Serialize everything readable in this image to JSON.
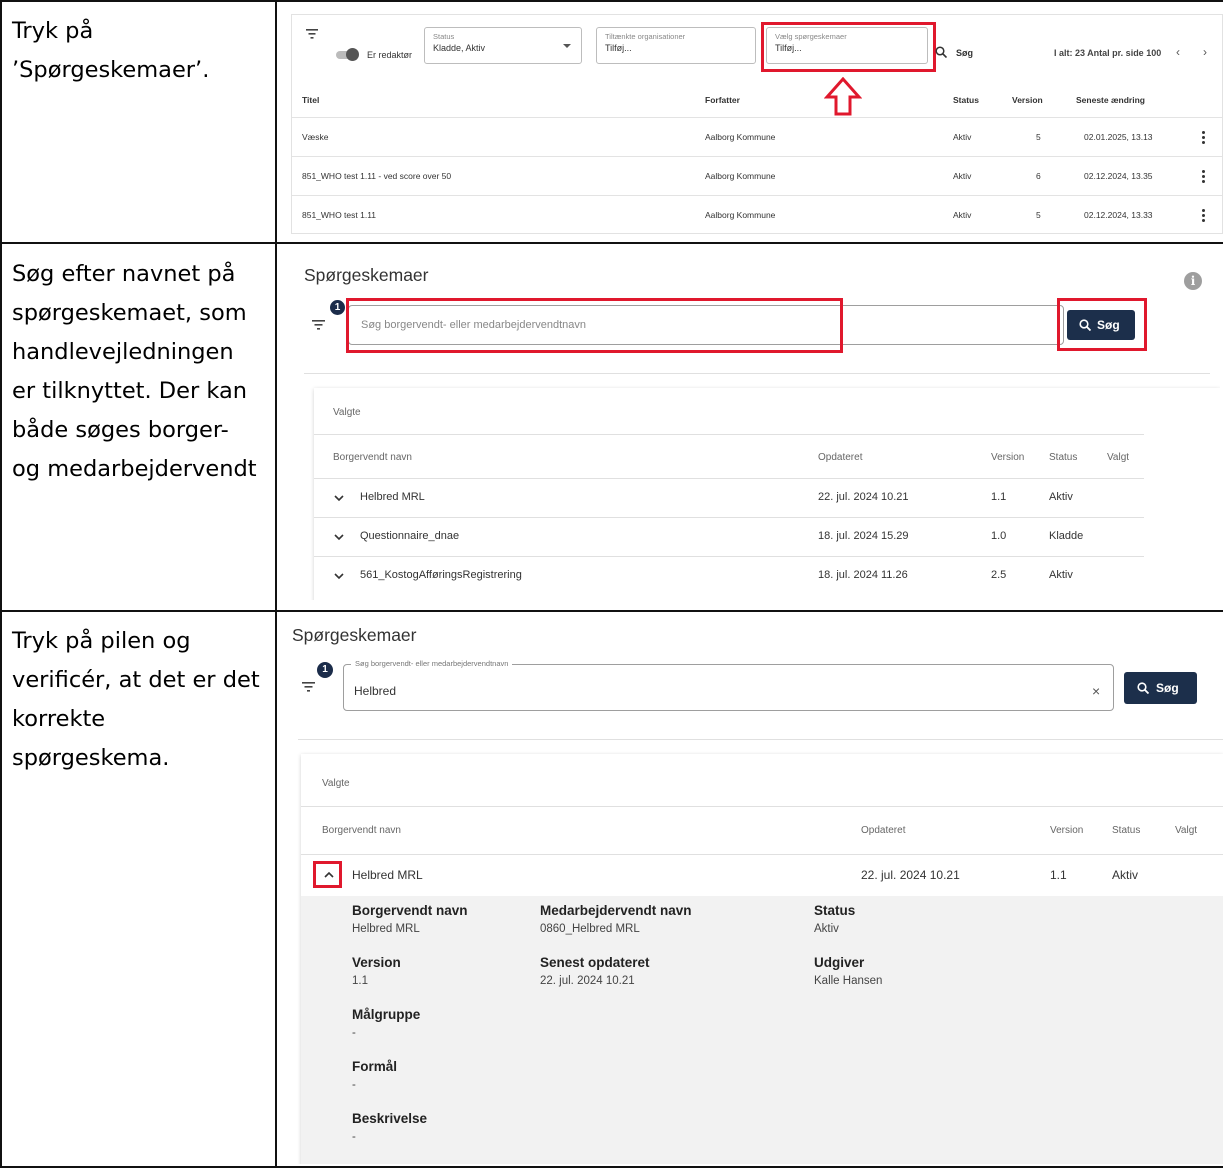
{
  "steps": [
    {
      "text": "Tryk på ’Spørgeskemaer’."
    },
    {
      "text": "Søg efter navnet på spørgeskemaet, som handlevejledningen er tilknyttet. Der kan både søges borger- og medarbejdervendt"
    },
    {
      "text": "Tryk på pilen og verificér, at det er det korrekte spørgeskema."
    }
  ],
  "list_view": {
    "toggle_label": "Er redaktør",
    "status_label": "Status",
    "status_value": "Kladde, Aktiv",
    "orgs_label": "Tiltænkte organisationer",
    "orgs_placeholder": "Tilføj...",
    "questionnaire_label": "Vælg spørgeskemaer",
    "questionnaire_placeholder": "Tilføj...",
    "search_label": "Søg",
    "total_text": "I alt: 23 Antal pr. side 100",
    "columns": {
      "title": "Titel",
      "author": "Forfatter",
      "status": "Status",
      "version": "Version",
      "changed": "Seneste ændring"
    },
    "rows": [
      {
        "title": "Væske",
        "author": "Aalborg Kommune",
        "status": "Aktiv",
        "version": "5",
        "changed": "02.01.2025, 13.13"
      },
      {
        "title": "851_WHO test 1.11 - ved score over 50",
        "author": "Aalborg Kommune",
        "status": "Aktiv",
        "version": "6",
        "changed": "02.12.2024, 13.35"
      },
      {
        "title": "851_WHO test 1.11",
        "author": "Aalborg Kommune",
        "status": "Aktiv",
        "version": "5",
        "changed": "02.12.2024, 13.33"
      }
    ]
  },
  "search_view": {
    "heading": "Spørgeskemaer",
    "badge": "1",
    "placeholder": "Søg borgervendt- eller medarbejdervendtnavn",
    "search_button": "Søg",
    "section_title": "Valgte",
    "columns": {
      "name": "Borgervendt navn",
      "updated": "Opdateret",
      "version": "Version",
      "status": "Status",
      "selected": "Valgt"
    },
    "rows": [
      {
        "name": "Helbred MRL",
        "updated": "22. jul. 2024 10.21",
        "version": "1.1",
        "status": "Aktiv"
      },
      {
        "name": "Questionnaire_dnae",
        "updated": "18. jul. 2024 15.29",
        "version": "1.0",
        "status": "Kladde"
      },
      {
        "name": "561_KostogAfføringsRegistrering",
        "updated": "18. jul. 2024 11.26",
        "version": "2.5",
        "status": "Aktiv"
      }
    ]
  },
  "detail_view": {
    "heading": "Spørgeskemaer",
    "badge": "1",
    "field_label": "Søg borgervendt- eller medarbejdervendtnavn",
    "field_value": "Helbred",
    "clear": "×",
    "search_button": "Søg",
    "section_title": "Valgte",
    "columns": {
      "name": "Borgervendt navn",
      "updated": "Opdateret",
      "version": "Version",
      "status": "Status",
      "selected": "Valgt"
    },
    "row": {
      "name": "Helbred MRL",
      "updated": "22. jul. 2024 10.21",
      "version": "1.1",
      "status": "Aktiv"
    },
    "details": {
      "citizen_name_label": "Borgervendt navn",
      "citizen_name": "Helbred MRL",
      "staff_name_label": "Medarbejdervendt navn",
      "staff_name": "0860_Helbred MRL",
      "status_label": "Status",
      "status": "Aktiv",
      "version_label": "Version",
      "version": "1.1",
      "updated_label": "Senest opdateret",
      "updated": "22. jul. 2024 10.21",
      "publisher_label": "Udgiver",
      "publisher": "Kalle Hansen",
      "target_label": "Målgruppe",
      "target": "-",
      "purpose_label": "Formål",
      "purpose": "-",
      "description_label": "Beskrivelse",
      "description": "-"
    }
  },
  "colors": {
    "highlight": "#e0182d",
    "button": "#1c2f4b"
  }
}
